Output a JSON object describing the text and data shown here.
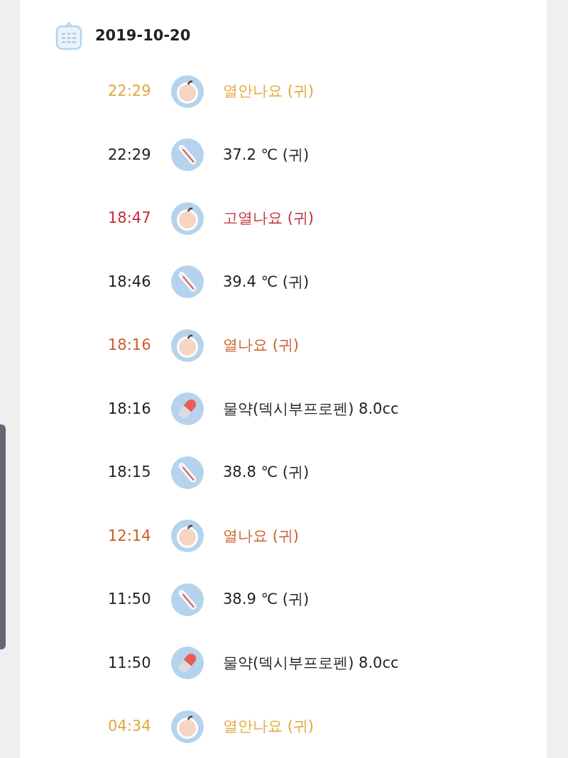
{
  "date": "2019-10-20",
  "entries": [
    {
      "time": "22:29",
      "kind": "baby",
      "text": "열안나요 (귀)",
      "color": "#e0a83a"
    },
    {
      "time": "22:29",
      "kind": "thermometer",
      "text": "37.2 ℃ (귀)",
      "color": "#222222"
    },
    {
      "time": "18:47",
      "kind": "baby",
      "text": "고열나요 (귀)",
      "color": "#c0303a"
    },
    {
      "time": "18:46",
      "kind": "thermometer",
      "text": "39.4 ℃ (귀)",
      "color": "#222222"
    },
    {
      "time": "18:16",
      "kind": "baby",
      "text": "열나요 (귀)",
      "color": "#c8602c"
    },
    {
      "time": "18:16",
      "kind": "medicine",
      "text": "물약(덱시부프로펜) 8.0cc",
      "color": "#222222"
    },
    {
      "time": "18:15",
      "kind": "thermometer",
      "text": "38.8 ℃ (귀)",
      "color": "#222222"
    },
    {
      "time": "12:14",
      "kind": "baby",
      "text": "열나요 (귀)",
      "color": "#c8602c"
    },
    {
      "time": "11:50",
      "kind": "thermometer",
      "text": "38.9 ℃ (귀)",
      "color": "#222222"
    },
    {
      "time": "11:50",
      "kind": "medicine",
      "text": "물약(덱시부프로펜) 8.0cc",
      "color": "#222222"
    },
    {
      "time": "04:34",
      "kind": "baby",
      "text": "열안나요 (귀)",
      "color": "#e0a83a"
    }
  ]
}
